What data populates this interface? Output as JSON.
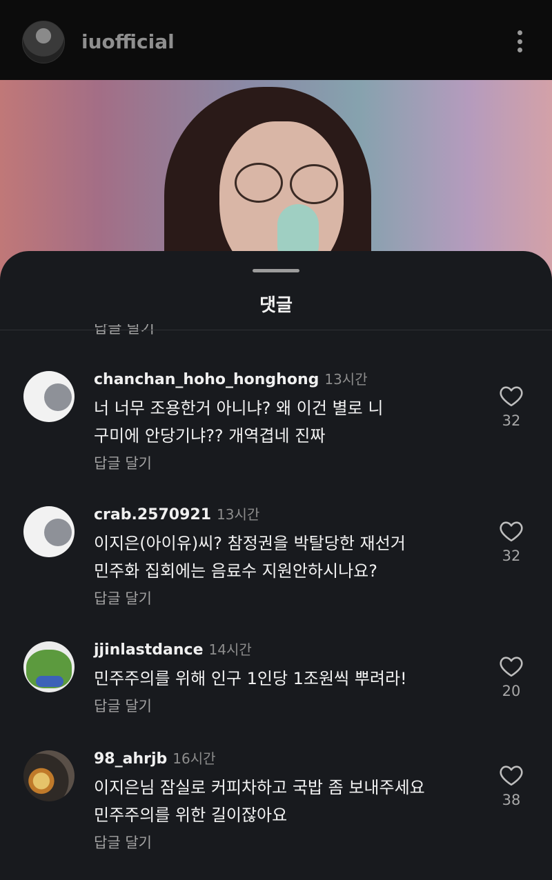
{
  "header": {
    "username": "iuofficial",
    "avatar_icon": "profile-photo",
    "menu_icon": "more-vertical-icon"
  },
  "sheet": {
    "title": "댓글",
    "cut_reply_label": "답글 달기"
  },
  "comments": [
    {
      "username": "chanchan_hoho_honghong",
      "time": "13시간",
      "text_lines": [
        "너 너무 조용한거 아니냐? 왜 이건 별로 니",
        "구미에 안당기냐?? 개역겹네 진짜"
      ],
      "reply_label": "답글 달기",
      "likes": "32",
      "avatar": "default-avatar"
    },
    {
      "username": "crab.2570921",
      "time": "13시간",
      "text_lines": [
        "이지은(아이유)씨? 참정권을 박탈당한 재선거",
        "민주화 집회에는 음료수 지원안하시나요?"
      ],
      "reply_label": "답글 달기",
      "likes": "32",
      "avatar": "default-avatar"
    },
    {
      "username": "jjinlastdance",
      "time": "14시간",
      "text_lines": [
        "민주주의를 위해 인구 1인당 1조원씩 뿌려라!"
      ],
      "reply_label": "답글 달기",
      "likes": "20",
      "avatar": "frog-avatar"
    },
    {
      "username": "98_ahrjb",
      "time": "16시간",
      "text_lines": [
        "이지은님 잠실로 커피차하고 국밥 좀 보내주세요",
        "민주주의를 위한 길이잖아요"
      ],
      "reply_label": "답글 달기",
      "likes": "38",
      "avatar": "food-avatar"
    }
  ],
  "colors": {
    "sheet_bg": "#181a1e",
    "header_bg": "#0c0c0c",
    "secondary_text": "#a3a3a3"
  }
}
